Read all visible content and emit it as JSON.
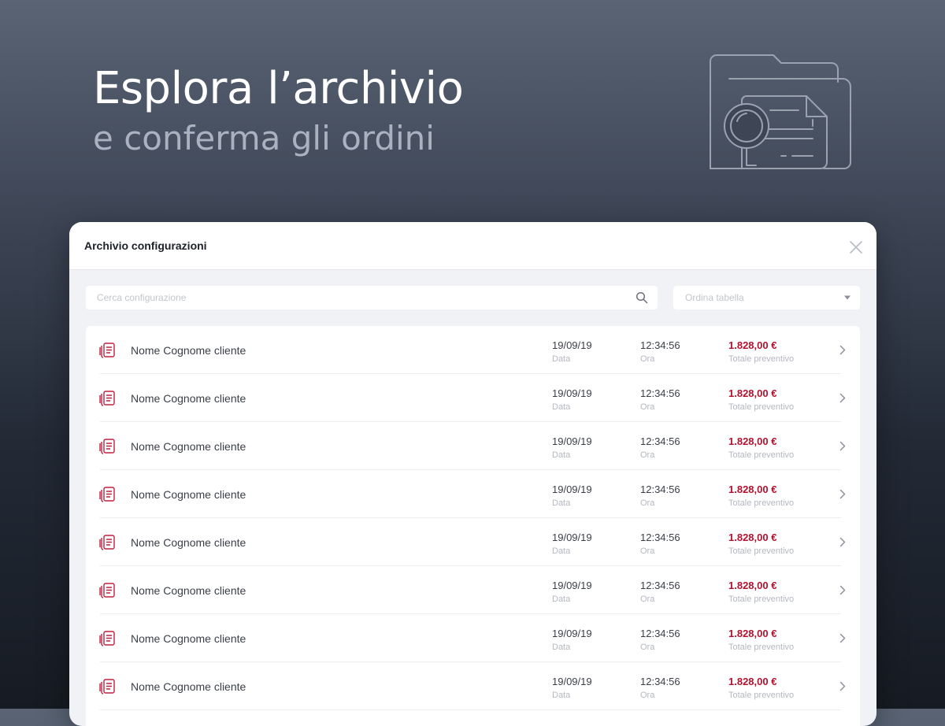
{
  "hero": {
    "title": "Esplora l’archivio",
    "subtitle": "e conferma gli ordini",
    "illustration_icon": "folder-document-magnifier-icon"
  },
  "modal": {
    "title": "Archivio configurazioni",
    "close_icon": "close-icon",
    "search": {
      "placeholder": "Cerca configurazione",
      "value": "",
      "icon": "search-icon"
    },
    "sort": {
      "placeholder": "Ordina tabella",
      "icon": "chevron-down-icon"
    },
    "colors": {
      "accent": "#b3122e",
      "background": "#f0f2f5"
    },
    "rows": [
      {
        "client": "Nome Cognome cliente",
        "date": "19/09/19",
        "date_label": "Data",
        "time": "12:34:56",
        "time_label": "Ora",
        "total": "1.828,00 €",
        "total_label": "Totale preventivo"
      },
      {
        "client": "Nome Cognome cliente",
        "date": "19/09/19",
        "date_label": "Data",
        "time": "12:34:56",
        "time_label": "Ora",
        "total": "1.828,00 €",
        "total_label": "Totale preventivo"
      },
      {
        "client": "Nome Cognome cliente",
        "date": "19/09/19",
        "date_label": "Data",
        "time": "12:34:56",
        "time_label": "Ora",
        "total": "1.828,00 €",
        "total_label": "Totale preventivo"
      },
      {
        "client": "Nome Cognome cliente",
        "date": "19/09/19",
        "date_label": "Data",
        "time": "12:34:56",
        "time_label": "Ora",
        "total": "1.828,00 €",
        "total_label": "Totale preventivo"
      },
      {
        "client": "Nome Cognome cliente",
        "date": "19/09/19",
        "date_label": "Data",
        "time": "12:34:56",
        "time_label": "Ora",
        "total": "1.828,00 €",
        "total_label": "Totale preventivo"
      },
      {
        "client": "Nome Cognome cliente",
        "date": "19/09/19",
        "date_label": "Data",
        "time": "12:34:56",
        "time_label": "Ora",
        "total": "1.828,00 €",
        "total_label": "Totale preventivo"
      },
      {
        "client": "Nome Cognome cliente",
        "date": "19/09/19",
        "date_label": "Data",
        "time": "12:34:56",
        "time_label": "Ora",
        "total": "1.828,00 €",
        "total_label": "Totale preventivo"
      },
      {
        "client": "Nome Cognome cliente",
        "date": "19/09/19",
        "date_label": "Data",
        "time": "12:34:56",
        "time_label": "Ora",
        "total": "1.828,00 €",
        "total_label": "Totale preventivo"
      }
    ]
  }
}
